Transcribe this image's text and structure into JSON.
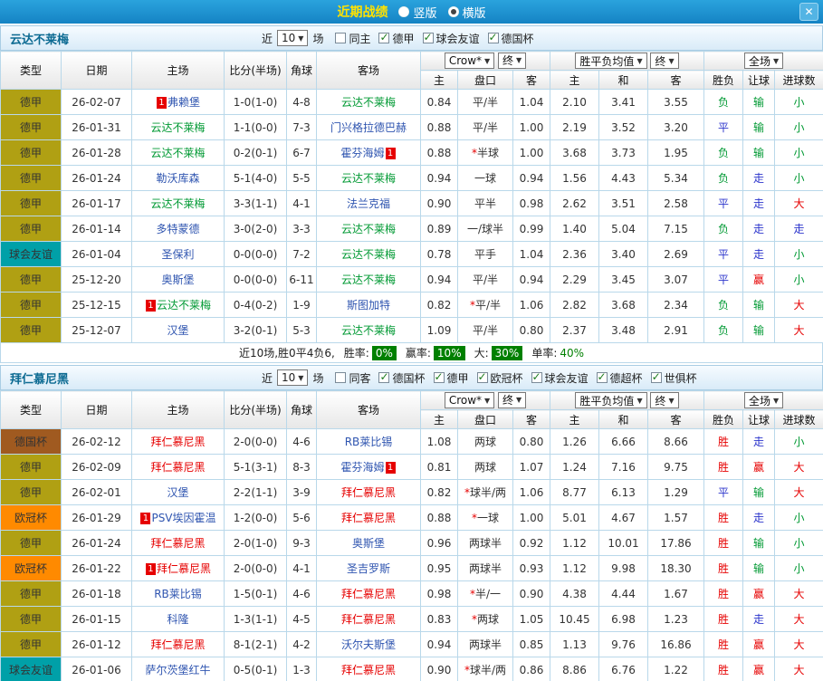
{
  "titlebar": {
    "title": "近期战绩",
    "layout_options": [
      {
        "label": "竖版",
        "selected": false
      },
      {
        "label": "横版",
        "selected": true
      }
    ]
  },
  "icons": {
    "chevron_down": "▼",
    "close": "✕",
    "check": "✓"
  },
  "table_template": {
    "near_label": "近",
    "count_value": "10",
    "games_label": "场",
    "headers": {
      "type": "类型",
      "date": "日期",
      "home": "主场",
      "score": "比分(半场)",
      "corners": "角球",
      "away": "客场",
      "asia": [
        "主",
        "盘口",
        "客"
      ],
      "europe": [
        "主",
        "和",
        "客"
      ],
      "result": [
        "胜负",
        "让球",
        "进球数"
      ]
    },
    "selects": {
      "bookmaker": "Crow*",
      "final_asia": "终",
      "europe_avg": "胜平负均值",
      "final_europe": "终",
      "scope": "全场"
    }
  },
  "colors": {
    "league": {
      "德甲": "#b0a013",
      "球会友谊": "#00a0a8",
      "德国杯": "#a05a20",
      "欧冠杯": "#ff8a00"
    },
    "opponent_team": "#2f55b0",
    "score": "#d40000",
    "red_card_badge": "#e60000",
    "outcome_win": "#e60000",
    "outcome_draw": "#2c35cc",
    "outcome_loss": "#009933",
    "summary_badge_bg": "#008000"
  },
  "sections": [
    {
      "team": "云达不莱梅",
      "team_color": "#009933",
      "filters": [
        {
          "label": "同主",
          "checked": false
        },
        {
          "label": "德甲",
          "checked": true
        },
        {
          "label": "球会友谊",
          "checked": true
        },
        {
          "label": "德国杯",
          "checked": true
        }
      ],
      "rows": [
        {
          "league": "德甲",
          "date": "26-02-07",
          "home": {
            "name": "弗赖堡",
            "side": "opp",
            "badge": "1",
            "badge_pos": "before"
          },
          "score": "1-0(1-0)",
          "corners": "4-8",
          "away": {
            "name": "云达不莱梅",
            "side": "self"
          },
          "asia": [
            "0.84",
            "平/半",
            "1.04"
          ],
          "europe": [
            "2.10",
            "3.41",
            "3.55"
          ],
          "outcome": [
            "负",
            "输",
            "小"
          ]
        },
        {
          "league": "德甲",
          "date": "26-01-31",
          "home": {
            "name": "云达不莱梅",
            "side": "self"
          },
          "score": "1-1(0-0)",
          "corners": "7-3",
          "away": {
            "name": "门兴格拉德巴赫",
            "side": "opp"
          },
          "asia": [
            "0.88",
            "平/半",
            "1.00"
          ],
          "europe": [
            "2.19",
            "3.52",
            "3.20"
          ],
          "outcome": [
            "平",
            "输",
            "小"
          ]
        },
        {
          "league": "德甲",
          "date": "26-01-28",
          "home": {
            "name": "云达不莱梅",
            "side": "self"
          },
          "score": "0-2(0-1)",
          "corners": "6-7",
          "away": {
            "name": "霍芬海姆",
            "side": "opp",
            "badge": "1",
            "badge_pos": "after"
          },
          "asia": [
            "0.88",
            "*半球",
            "1.00"
          ],
          "europe": [
            "3.68",
            "3.73",
            "1.95"
          ],
          "outcome": [
            "负",
            "输",
            "小"
          ]
        },
        {
          "league": "德甲",
          "date": "26-01-24",
          "home": {
            "name": "勒沃库森",
            "side": "opp"
          },
          "score": "5-1(4-0)",
          "corners": "5-5",
          "away": {
            "name": "云达不莱梅",
            "side": "self"
          },
          "asia": [
            "0.94",
            "一球",
            "0.94"
          ],
          "europe": [
            "1.56",
            "4.43",
            "5.34"
          ],
          "outcome": [
            "负",
            "走",
            "小"
          ]
        },
        {
          "league": "德甲",
          "date": "26-01-17",
          "home": {
            "name": "云达不莱梅",
            "side": "self"
          },
          "score": "3-3(1-1)",
          "corners": "4-1",
          "away": {
            "name": "法兰克福",
            "side": "opp"
          },
          "asia": [
            "0.90",
            "平半",
            "0.98"
          ],
          "europe": [
            "2.62",
            "3.51",
            "2.58"
          ],
          "outcome": [
            "平",
            "走",
            "大"
          ]
        },
        {
          "league": "德甲",
          "date": "26-01-14",
          "home": {
            "name": "多特蒙德",
            "side": "opp"
          },
          "score": "3-0(2-0)",
          "corners": "3-3",
          "away": {
            "name": "云达不莱梅",
            "side": "self"
          },
          "asia": [
            "0.89",
            "一/球半",
            "0.99"
          ],
          "europe": [
            "1.40",
            "5.04",
            "7.15"
          ],
          "outcome": [
            "负",
            "走",
            "走"
          ]
        },
        {
          "league": "球会友谊",
          "date": "26-01-04",
          "home": {
            "name": "圣保利",
            "side": "opp"
          },
          "score": "0-0(0-0)",
          "corners": "7-2",
          "away": {
            "name": "云达不莱梅",
            "side": "self"
          },
          "asia": [
            "0.78",
            "平手",
            "1.04"
          ],
          "europe": [
            "2.36",
            "3.40",
            "2.69"
          ],
          "outcome": [
            "平",
            "走",
            "小"
          ]
        },
        {
          "league": "德甲",
          "date": "25-12-20",
          "home": {
            "name": "奥斯堡",
            "side": "opp"
          },
          "score": "0-0(0-0)",
          "corners": "6-11",
          "away": {
            "name": "云达不莱梅",
            "side": "self"
          },
          "asia": [
            "0.94",
            "平/半",
            "0.94"
          ],
          "europe": [
            "2.29",
            "3.45",
            "3.07"
          ],
          "outcome": [
            "平",
            "赢",
            "小"
          ]
        },
        {
          "league": "德甲",
          "date": "25-12-15",
          "home": {
            "name": "云达不莱梅",
            "side": "self",
            "badge": "1",
            "badge_pos": "before"
          },
          "score": "0-4(0-2)",
          "corners": "1-9",
          "away": {
            "name": "斯图加特",
            "side": "opp"
          },
          "asia": [
            "0.82",
            "*平/半",
            "1.06"
          ],
          "europe": [
            "2.82",
            "3.68",
            "2.34"
          ],
          "outcome": [
            "负",
            "输",
            "大"
          ]
        },
        {
          "league": "德甲",
          "date": "25-12-07",
          "home": {
            "name": "汉堡",
            "side": "opp"
          },
          "score": "3-2(0-1)",
          "corners": "5-3",
          "away": {
            "name": "云达不莱梅",
            "side": "self"
          },
          "asia": [
            "1.09",
            "平/半",
            "0.80"
          ],
          "europe": [
            "2.37",
            "3.48",
            "2.91"
          ],
          "outcome": [
            "负",
            "输",
            "大"
          ]
        }
      ],
      "summary": {
        "record_text": "近10场,胜0平4负6,",
        "stats": [
          {
            "label": "胜率:",
            "value": "0%",
            "badge": true
          },
          {
            "label": "赢率:",
            "value": "10%",
            "badge": true
          },
          {
            "label": "大:",
            "value": "30%",
            "badge": true
          },
          {
            "label": "单率:",
            "value": "40%",
            "badge": false
          }
        ]
      }
    },
    {
      "team": "拜仁慕尼黑",
      "team_color": "#e60000",
      "filters": [
        {
          "label": "同客",
          "checked": false
        },
        {
          "label": "德国杯",
          "checked": true
        },
        {
          "label": "德甲",
          "checked": true
        },
        {
          "label": "欧冠杯",
          "checked": true
        },
        {
          "label": "球会友谊",
          "checked": true
        },
        {
          "label": "德超杯",
          "checked": true
        },
        {
          "label": "世俱杯",
          "checked": true
        }
      ],
      "rows": [
        {
          "league": "德国杯",
          "date": "26-02-12",
          "home": {
            "name": "拜仁慕尼黑",
            "side": "self"
          },
          "score": "2-0(0-0)",
          "corners": "4-6",
          "away": {
            "name": "RB莱比锡",
            "side": "opp"
          },
          "asia": [
            "1.08",
            "两球",
            "0.80"
          ],
          "europe": [
            "1.26",
            "6.66",
            "8.66"
          ],
          "outcome": [
            "胜",
            "走",
            "小"
          ]
        },
        {
          "league": "德甲",
          "date": "26-02-09",
          "home": {
            "name": "拜仁慕尼黑",
            "side": "self"
          },
          "score": "5-1(3-1)",
          "corners": "8-3",
          "away": {
            "name": "霍芬海姆",
            "side": "opp",
            "badge": "1",
            "badge_pos": "after"
          },
          "asia": [
            "0.81",
            "两球",
            "1.07"
          ],
          "europe": [
            "1.24",
            "7.16",
            "9.75"
          ],
          "outcome": [
            "胜",
            "赢",
            "大"
          ]
        },
        {
          "league": "德甲",
          "date": "26-02-01",
          "home": {
            "name": "汉堡",
            "side": "opp"
          },
          "score": "2-2(1-1)",
          "corners": "3-9",
          "away": {
            "name": "拜仁慕尼黑",
            "side": "self"
          },
          "asia": [
            "0.82",
            "*球半/两",
            "1.06"
          ],
          "europe": [
            "8.77",
            "6.13",
            "1.29"
          ],
          "outcome": [
            "平",
            "输",
            "大"
          ]
        },
        {
          "league": "欧冠杯",
          "date": "26-01-29",
          "home": {
            "name": "PSV埃因霍温",
            "side": "opp",
            "badge": "1",
            "badge_pos": "before"
          },
          "score": "1-2(0-0)",
          "corners": "5-6",
          "away": {
            "name": "拜仁慕尼黑",
            "side": "self"
          },
          "asia": [
            "0.88",
            "*一球",
            "1.00"
          ],
          "europe": [
            "5.01",
            "4.67",
            "1.57"
          ],
          "outcome": [
            "胜",
            "走",
            "小"
          ]
        },
        {
          "league": "德甲",
          "date": "26-01-24",
          "home": {
            "name": "拜仁慕尼黑",
            "side": "self"
          },
          "score": "2-0(1-0)",
          "corners": "9-3",
          "away": {
            "name": "奥斯堡",
            "side": "opp"
          },
          "asia": [
            "0.96",
            "两球半",
            "0.92"
          ],
          "europe": [
            "1.12",
            "10.01",
            "17.86"
          ],
          "outcome": [
            "胜",
            "输",
            "小"
          ]
        },
        {
          "league": "欧冠杯",
          "date": "26-01-22",
          "home": {
            "name": "拜仁慕尼黑",
            "side": "self",
            "badge": "1",
            "badge_pos": "before"
          },
          "score": "2-0(0-0)",
          "corners": "4-1",
          "away": {
            "name": "圣吉罗斯",
            "side": "opp"
          },
          "asia": [
            "0.95",
            "两球半",
            "0.93"
          ],
          "europe": [
            "1.12",
            "9.98",
            "18.30"
          ],
          "outcome": [
            "胜",
            "输",
            "小"
          ]
        },
        {
          "league": "德甲",
          "date": "26-01-18",
          "home": {
            "name": "RB莱比锡",
            "side": "opp"
          },
          "score": "1-5(0-1)",
          "corners": "4-6",
          "away": {
            "name": "拜仁慕尼黑",
            "side": "self"
          },
          "asia": [
            "0.98",
            "*半/一",
            "0.90"
          ],
          "europe": [
            "4.38",
            "4.44",
            "1.67"
          ],
          "outcome": [
            "胜",
            "赢",
            "大"
          ]
        },
        {
          "league": "德甲",
          "date": "26-01-15",
          "home": {
            "name": "科隆",
            "side": "opp"
          },
          "score": "1-3(1-1)",
          "corners": "4-5",
          "away": {
            "name": "拜仁慕尼黑",
            "side": "self"
          },
          "asia": [
            "0.83",
            "*两球",
            "1.05"
          ],
          "europe": [
            "10.45",
            "6.98",
            "1.23"
          ],
          "outcome": [
            "胜",
            "走",
            "大"
          ]
        },
        {
          "league": "德甲",
          "date": "26-01-12",
          "home": {
            "name": "拜仁慕尼黑",
            "side": "self"
          },
          "score": "8-1(2-1)",
          "corners": "4-2",
          "away": {
            "name": "沃尔夫斯堡",
            "side": "opp"
          },
          "asia": [
            "0.94",
            "两球半",
            "0.85"
          ],
          "europe": [
            "1.13",
            "9.76",
            "16.86"
          ],
          "outcome": [
            "胜",
            "赢",
            "大"
          ]
        },
        {
          "league": "球会友谊",
          "date": "26-01-06",
          "home": {
            "name": "萨尔茨堡红牛",
            "side": "opp"
          },
          "score": "0-5(0-1)",
          "corners": "1-3",
          "away": {
            "name": "拜仁慕尼黑",
            "side": "self"
          },
          "asia": [
            "0.90",
            "*球半/两",
            "0.86"
          ],
          "europe": [
            "8.86",
            "6.76",
            "1.22"
          ],
          "outcome": [
            "胜",
            "赢",
            "大"
          ]
        }
      ],
      "summary": null
    }
  ]
}
